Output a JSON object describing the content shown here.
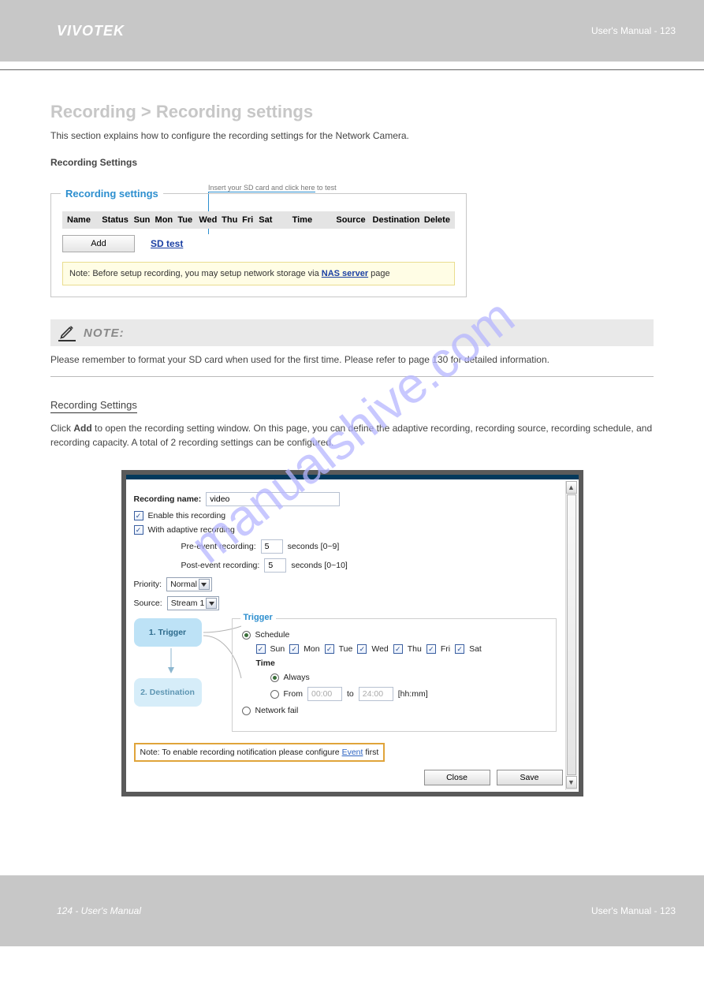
{
  "header": {
    "brand": "VIVOTEK",
    "manual_title": "User's Manual - 123"
  },
  "section": {
    "heading": "Recording > Recording settings",
    "intro": "This section explains how to configure the recording settings for the Network Camera."
  },
  "panel": {
    "sub_heading": "Recording Settings",
    "callout": "Insert your SD card and click here to test",
    "legend": "Recording settings",
    "columns": [
      "Name",
      "Status",
      "Sun",
      "Mon",
      "Tue",
      "Wed",
      "Thu",
      "Fri",
      "Sat",
      "Time",
      "Source",
      "Destination",
      "Delete"
    ],
    "add_label": "Add",
    "sd_test_label": "SD test",
    "note_prefix": "Note: Before setup recording, you may setup network storage via ",
    "note_link": "NAS server",
    "note_suffix": " page"
  },
  "note_strip": {
    "title": "NOTE:",
    "body": "Please remember to format your SD card when used for the first time. Please refer to page 130 for detailed information."
  },
  "recording_settings": {
    "title": "Recording Settings",
    "intro_1": "Click ",
    "intro_bold": "Add",
    "intro_2": " to open the recording setting window. On this page, you can define the adaptive recording, recording source, recording schedule, and recording capacity. A total of 2 recording settings can be configured."
  },
  "dialog": {
    "recording_name_label": "Recording name:",
    "recording_name_value": "video",
    "enable_label": "Enable this recording",
    "adaptive_label": "With adaptive recording",
    "pre_event_label": "Pre-event recording:",
    "pre_event_value": "5",
    "pre_event_hint": "seconds [0~9]",
    "post_event_label": "Post-event recording:",
    "post_event_value": "5",
    "post_event_hint": "seconds [0~10]",
    "priority_label": "Priority:",
    "priority_value": "Normal",
    "source_label": "Source:",
    "source_value": "Stream 1",
    "step1": "1. Trigger",
    "step2": "2. Destination",
    "trigger_legend": "Trigger",
    "schedule_label": "Schedule",
    "days": [
      "Sun",
      "Mon",
      "Tue",
      "Wed",
      "Thu",
      "Fri",
      "Sat"
    ],
    "time_label": "Time",
    "always_label": "Always",
    "from_label": "From",
    "from_value": "00:00",
    "to_label": "to",
    "to_value": "24:00",
    "hhmm": "[hh:mm]",
    "network_fail_label": "Network fail",
    "event_note_prefix": "Note: To enable recording notification please configure ",
    "event_link": "Event",
    "event_note_suffix": " first",
    "close_label": "Close",
    "save_label": "Save"
  },
  "footer": {
    "left": "124 - User's Manual",
    "right": "User's Manual - 123"
  }
}
